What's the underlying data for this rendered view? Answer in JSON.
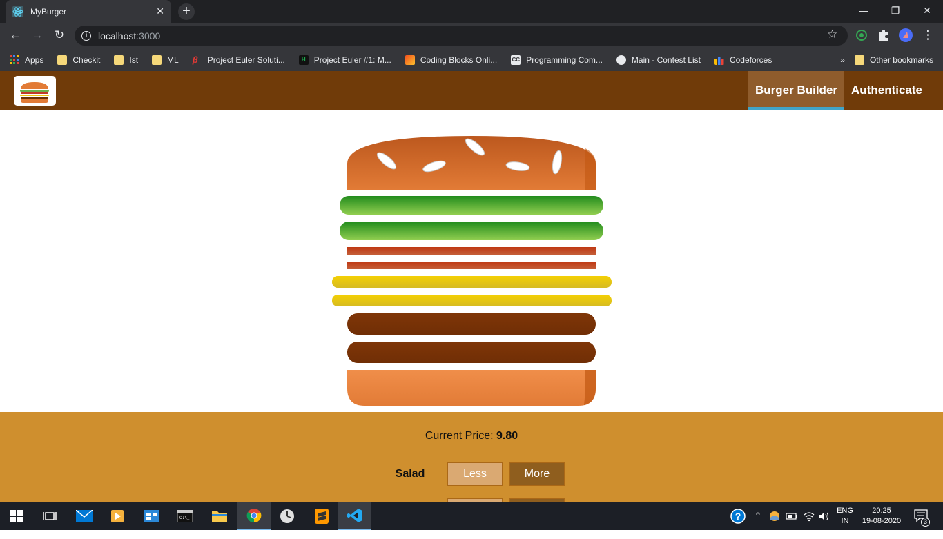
{
  "browser": {
    "tab_title": "MyBurger",
    "tab_close": "✕",
    "new_tab": "+",
    "url_host": "localhost",
    "url_port": ":3000",
    "window_controls": {
      "minimize": "—",
      "restore": "❐",
      "close": "✕"
    }
  },
  "bookmarks": [
    {
      "label": "Apps",
      "icon": "apps-grid-icon"
    },
    {
      "label": "Checkit",
      "icon": "folder-icon"
    },
    {
      "label": "Ist",
      "icon": "folder-icon"
    },
    {
      "label": "ML",
      "icon": "folder-icon"
    },
    {
      "label": "Project Euler Soluti...",
      "icon": "project-euler-icon"
    },
    {
      "label": "Project Euler #1: M...",
      "icon": "hackerrank-icon"
    },
    {
      "label": "Coding Blocks Onli...",
      "icon": "coding-blocks-icon"
    },
    {
      "label": "Programming Com...",
      "icon": "codechef-icon"
    },
    {
      "label": "Main - Contest List",
      "icon": "globe-icon"
    },
    {
      "label": "Codeforces",
      "icon": "codeforces-icon"
    }
  ],
  "bookmarks_overflow": "»",
  "other_bookmarks": "Other bookmarks",
  "app": {
    "nav": {
      "burger_builder": "Burger Builder",
      "authenticate": "Authenticate"
    },
    "burger": {
      "ingredients": [
        "salad",
        "salad",
        "bacon",
        "bacon",
        "cheese",
        "cheese",
        "meat",
        "meat"
      ]
    },
    "controls": {
      "price_label": "Current Price:",
      "price_value": "9.80",
      "rows": [
        {
          "label": "Salad",
          "less": "Less",
          "more": "More"
        },
        {
          "label": "",
          "less": "",
          "more": ""
        }
      ]
    }
  },
  "taskbar": {
    "lang_top": "ENG",
    "lang_bottom": "IN",
    "time": "20:25",
    "date": "19-08-2020",
    "notification_count": "3"
  },
  "colors": {
    "header": "#703b09",
    "controls": "#cf8f2e",
    "bread": "#e27b36",
    "salad": "#4c9d29",
    "bacon": "#bf3813",
    "cheese": "#e5c20c",
    "meat": "#7f3608"
  }
}
